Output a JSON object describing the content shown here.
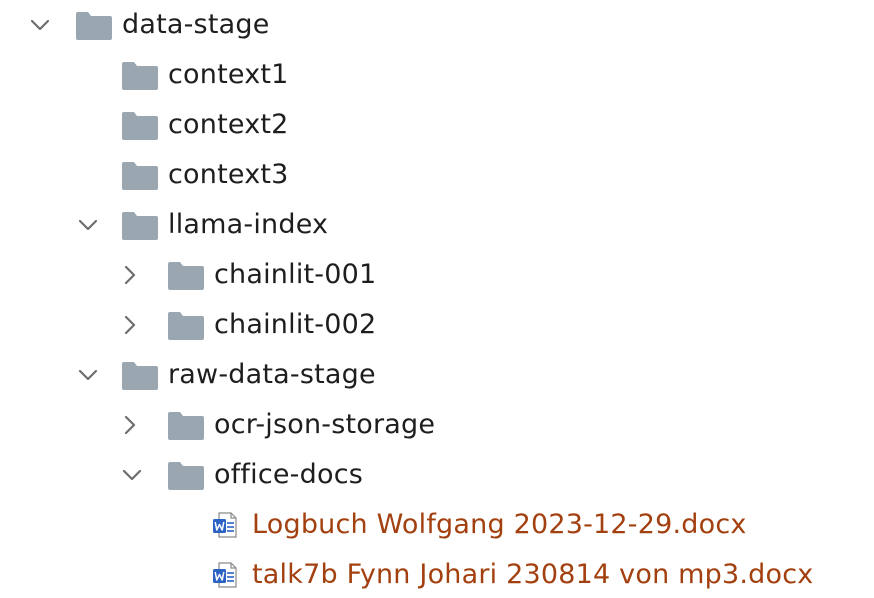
{
  "tree": {
    "root": {
      "label": "data-stage",
      "state": "expanded",
      "icon": "folder-icon"
    },
    "items": [
      {
        "label": "context1",
        "state": "leaf",
        "icon": "folder-icon"
      },
      {
        "label": "context2",
        "state": "leaf",
        "icon": "folder-icon"
      },
      {
        "label": "context3",
        "state": "leaf",
        "icon": "folder-icon"
      },
      {
        "label": "llama-index",
        "state": "expanded",
        "icon": "folder-icon"
      },
      {
        "label": "chainlit-001",
        "state": "collapsed",
        "icon": "folder-icon"
      },
      {
        "label": "chainlit-002",
        "state": "collapsed",
        "icon": "folder-icon"
      },
      {
        "label": "raw-data-stage",
        "state": "expanded",
        "icon": "folder-icon"
      },
      {
        "label": "ocr-json-storage",
        "state": "collapsed",
        "icon": "folder-icon"
      },
      {
        "label": "office-docs",
        "state": "expanded",
        "icon": "folder-icon"
      },
      {
        "label": "Logbuch Wolfgang 2023-12-29.docx",
        "state": "file",
        "icon": "word-document-icon"
      },
      {
        "label": "talk7b Fynn Johari 230814 von mp3.docx",
        "state": "file",
        "icon": "word-document-icon"
      }
    ]
  },
  "colors": {
    "folder": "#9aa7b1",
    "chevron": "#6e6e6e",
    "text": "#1e1e1e",
    "file_text": "#a3400f",
    "word_blue": "#2b62c4"
  }
}
